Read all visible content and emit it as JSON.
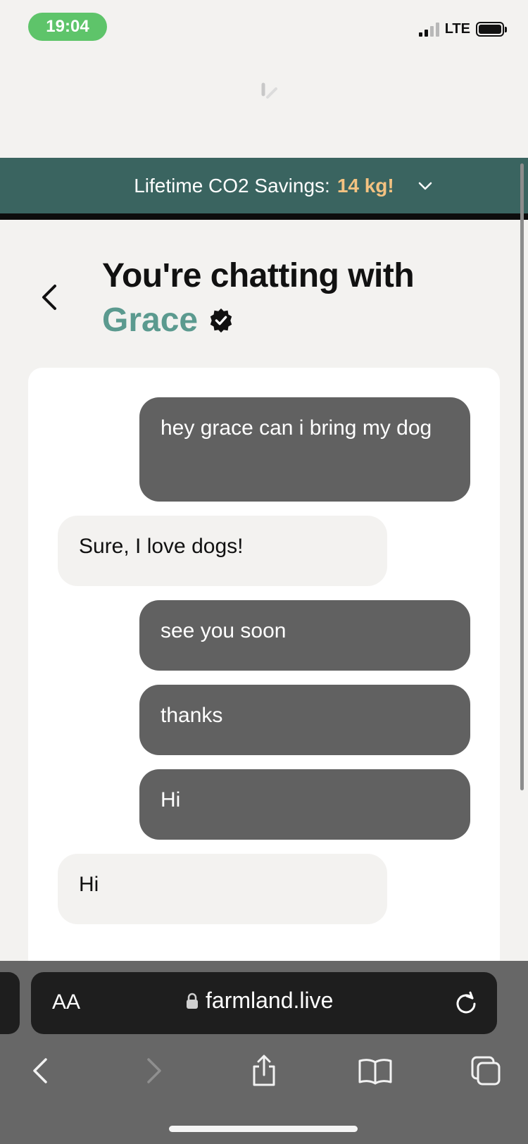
{
  "status_bar": {
    "time": "19:04",
    "network": "LTE"
  },
  "banner": {
    "label": "Lifetime CO2 Savings:",
    "value": "14 kg!",
    "value_color": "#f3c281",
    "background": "#3a6460"
  },
  "header": {
    "title": "You're chatting with",
    "contact_name": "Grace",
    "contact_color": "#5b9a8f"
  },
  "messages": [
    {
      "direction": "sent",
      "text": "hey grace can i bring my dog"
    },
    {
      "direction": "received",
      "text": "Sure, I love dogs!"
    },
    {
      "direction": "sent",
      "text": "see you soon"
    },
    {
      "direction": "sent",
      "text": "thanks"
    },
    {
      "direction": "sent",
      "text": "Hi"
    },
    {
      "direction": "received",
      "text": "Hi"
    }
  ],
  "browser": {
    "text_size_button": "AA",
    "url": "farmland.live"
  },
  "icons": {
    "back": "chevron-left-icon",
    "verified": "verified-badge-icon",
    "expand": "chevron-down-icon",
    "lock": "lock-icon",
    "reload": "reload-icon",
    "nav_back": "nav-back-icon",
    "nav_forward": "nav-forward-icon",
    "share": "share-icon",
    "bookmarks": "bookmarks-icon",
    "tabs": "tabs-icon"
  }
}
